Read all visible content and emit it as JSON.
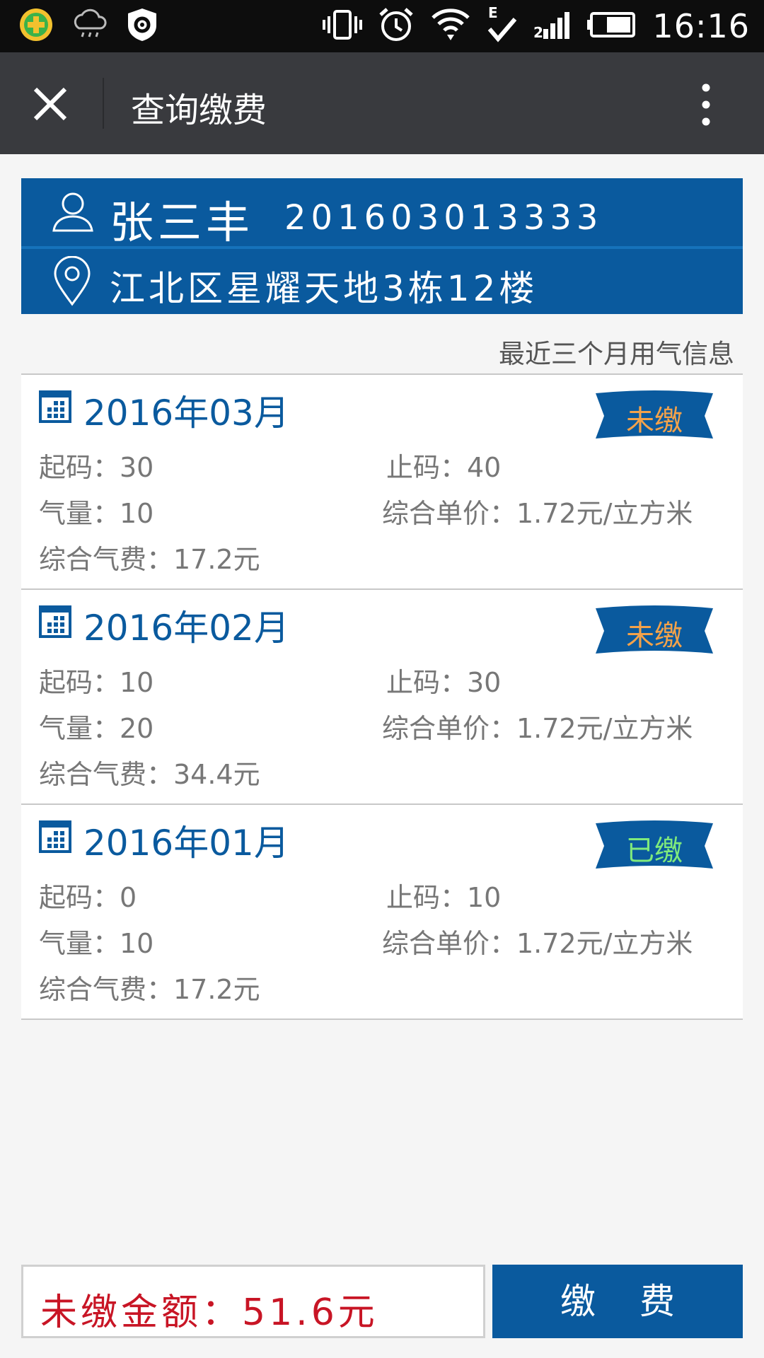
{
  "status_bar": {
    "time": "16:16",
    "icons": [
      "360-security-icon",
      "weather-cloud-icon",
      "shield-gear-icon",
      "vibrate-icon",
      "alarm-icon",
      "wifi-icon",
      "edge-data-icon",
      "signal-icon",
      "battery-icon"
    ]
  },
  "titlebar": {
    "title": "查询缴费",
    "close_icon": "close-icon",
    "more_icon": "more-vertical-icon"
  },
  "user": {
    "name": "张三丰",
    "account": "201603013333",
    "address": "江北区星耀天地3栋12楼"
  },
  "section_label": "最近三个月用气信息",
  "records": [
    {
      "month": "2016年03月",
      "status": "未缴",
      "status_color": "#f3a24a",
      "start": "起码：30",
      "end": "止码：40",
      "volume": "气量：10",
      "unit_price": "综合单价：1.72元/立方米",
      "fee": "综合气费：17.2元"
    },
    {
      "month": "2016年02月",
      "status": "未缴",
      "status_color": "#f3a24a",
      "start": "起码：10",
      "end": "止码：30",
      "volume": "气量：20",
      "unit_price": "综合单价：1.72元/立方米",
      "fee": "综合气费：34.4元"
    },
    {
      "month": "2016年01月",
      "status": "已缴",
      "status_color": "#7fea7c",
      "start": "起码：0",
      "end": "止码：10",
      "volume": "气量：10",
      "unit_price": "综合单价：1.72元/立方米",
      "fee": "综合气费：17.2元"
    }
  ],
  "footer": {
    "unpaid_amount": "未缴金额：51.6元",
    "pay_button": "缴费"
  },
  "colors": {
    "brand_blue": "#0a5a9e",
    "titlebar": "#393a3e",
    "amount_red": "#c81525"
  }
}
